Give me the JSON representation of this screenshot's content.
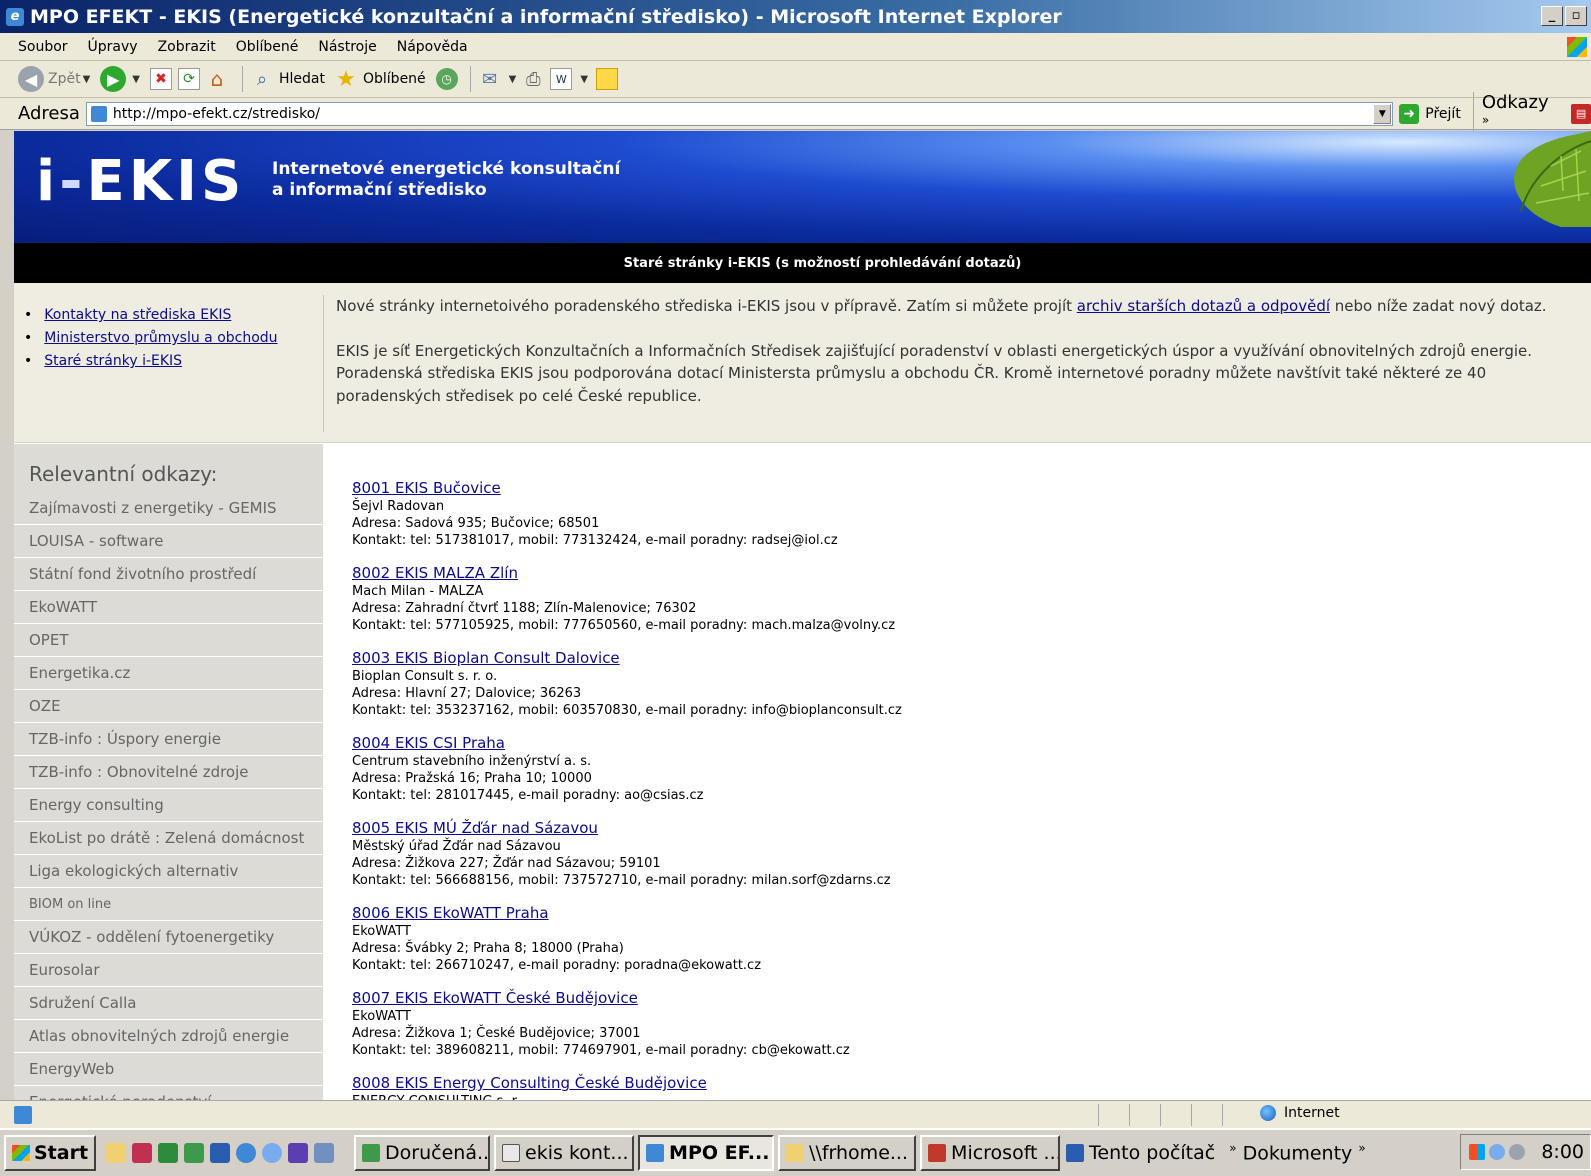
{
  "window": {
    "title": "MPO EFEKT - EKIS (Energetické konzultační a informační středisko) - Microsoft Internet Explorer"
  },
  "menu": [
    "Soubor",
    "Úpravy",
    "Zobrazit",
    "Oblíbené",
    "Nástroje",
    "Nápověda"
  ],
  "toolbar": {
    "back": "Zpět",
    "search": "Hledat",
    "favorites": "Oblíbené"
  },
  "address": {
    "label": "Adresa",
    "url": "http://mpo-efekt.cz/stredisko/",
    "go": "Přejít",
    "links": "Odkazy"
  },
  "banner": {
    "logo_i": "i",
    "logo_dash": "-",
    "logo_main": "EKIS",
    "tagline_line1": "Internetové energetické konsultační",
    "tagline_line2": "a informační středisko"
  },
  "nav_bar": {
    "text": "Staré stránky i-EKIS (s možností prohledávání dotazů)"
  },
  "quick_links": [
    "Kontakty na střediska EKIS",
    "Ministerstvo průmyslu a obchodu",
    "Staré stránky i-EKIS"
  ],
  "intro": {
    "p1_before": "Nové stránky internetoivého poradenského střediska i-EKIS jsou v přípravě. Zatím si můžete projít ",
    "p1_link": "archiv starších dotazů a odpovědí",
    "p1_after": " nebo níže zadat nový dotaz.",
    "p2": "EKIS je síť Energetických Konzultačních a Informačních Středisek zajišťující poradenství v oblasti energetických úspor a využívání obnovitelných zdrojů energie. Poradenská střediska EKIS jsou podporována dotací Ministersta průmyslu a obchodu ČR. Kromě internetové poradny můžete navštívit také některé ze 40 poradenských středisek po celé České republice."
  },
  "sidebar": {
    "heading": "Relevantní odkazy:",
    "items": [
      "Zajímavosti z energetiky - GEMIS",
      "LOUISA - software",
      "Státní fond životního prostředí",
      "EkoWATT",
      "OPET",
      "Energetika.cz",
      "OZE",
      "TZB-info : Úspory energie",
      "TZB-info : Obnovitelné zdroje",
      "Energy consulting",
      "EkoList po drátě : Zelená domácnost",
      "Liga ekologických alternativ",
      "BIOM on line",
      "VÚKOZ - oddělení fytoenergetiky",
      "Eurosolar",
      "Sdružení Calla",
      "Atlas obnovitelných zdrojů energie",
      "EnergyWeb",
      "Energetické poradenství"
    ]
  },
  "centers": [
    {
      "title": "8001 EKIS Bučovice",
      "org": "Šejvl Radovan",
      "address": "Adresa: Sadová 935; Bučovice; 68501",
      "contact": "Kontakt: tel: 517381017, mobil: 773132424, e-mail poradny: radsej@iol.cz"
    },
    {
      "title": "8002 EKIS MALZA Zlín",
      "org": "Mach Milan - MALZA",
      "address": "Adresa: Zahradní čtvrť 1188; Zlín-Malenovice; 76302",
      "contact": "Kontakt: tel: 577105925, mobil: 777650560, e-mail poradny: mach.malza@volny.cz"
    },
    {
      "title": "8003 EKIS Bioplan Consult Dalovice",
      "org": "Bioplan Consult s. r. o.",
      "address": "Adresa: Hlavní 27; Dalovice; 36263",
      "contact": "Kontakt: tel: 353237162, mobil: 603570830, e-mail poradny: info@bioplanconsult.cz"
    },
    {
      "title": "8004 EKIS CSI Praha",
      "org": "Centrum stavebního inženýrství a. s.",
      "address": "Adresa: Pražská 16; Praha 10; 10000",
      "contact": "Kontakt: tel: 281017445, e-mail poradny: ao@csias.cz"
    },
    {
      "title": "8005 EKIS MÚ Žďár nad Sázavou",
      "org": "Městský úřad Žďár nad Sázavou",
      "address": "Adresa: Žižkova 227; Žďár nad Sázavou; 59101",
      "contact": "Kontakt: tel: 566688156, mobil: 737572710, e-mail poradny: milan.sorf@zdarns.cz"
    },
    {
      "title": "8006 EKIS EkoWATT Praha",
      "org": "EkoWATT",
      "address": "Adresa: Švábky 2; Praha 8; 18000 (Praha)",
      "contact": "Kontakt: tel: 266710247, e-mail poradny: poradna@ekowatt.cz"
    },
    {
      "title": "8007 EKIS EkoWATT České Budějovice",
      "org": "EkoWATT",
      "address": "Adresa: Žižkova 1; České Budějovice; 37001",
      "contact": "Kontakt: tel: 389608211, mobil: 774697901, e-mail poradny: cb@ekowatt.cz"
    },
    {
      "title": "8008 EKIS Energy Consulting České Budějovice",
      "org": "ENERGY CONSULTING s. r.",
      "address": "",
      "contact": ""
    }
  ],
  "statusbar": {
    "zone": "Internet"
  },
  "taskbar": {
    "start": "Start",
    "tasks": [
      "Doručená...",
      "ekis kont...",
      "MPO EF...",
      "\\\\frhome...",
      "Microsoft ...",
      "Tento počítač"
    ],
    "tray_label": "Dokumenty",
    "chevron": "»",
    "clock": "8:00"
  },
  "colors": {
    "link": "#0b0b8c",
    "banner_dark": "#0b2a9c",
    "sidebar_bg": "#dcdbd6",
    "strip_bg": "#efede2"
  }
}
